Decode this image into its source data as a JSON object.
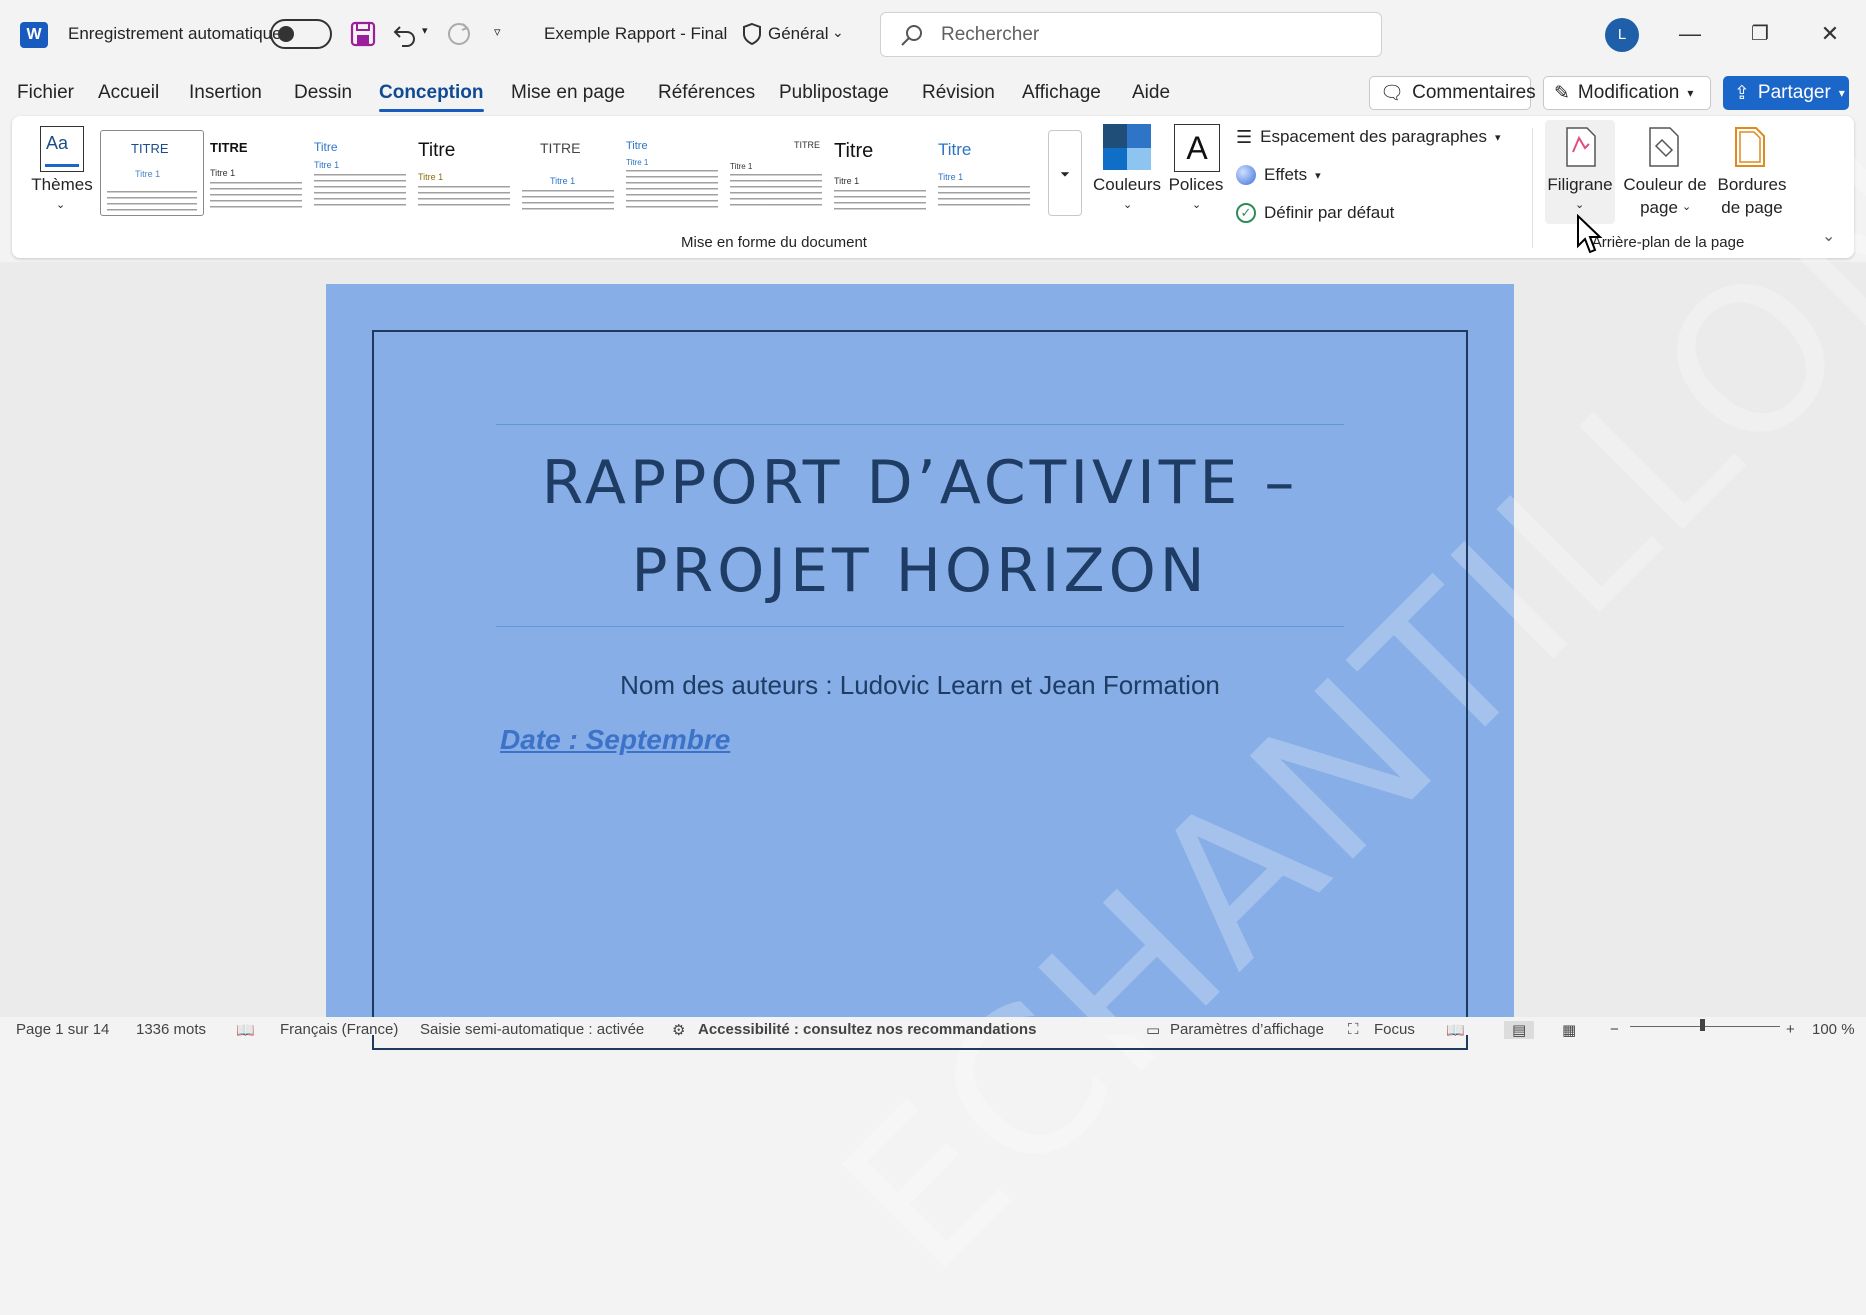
{
  "titlebar": {
    "autosave_label": "Enregistrement automatique",
    "doc_title": "Exemple Rapport - Final",
    "sensitivity": "Général",
    "search_placeholder": "Rechercher",
    "avatar_initial": "L"
  },
  "menu": {
    "tabs": [
      "Fichier",
      "Accueil",
      "Insertion",
      "Dessin",
      "Conception",
      "Mise en page",
      "Références",
      "Publipostage",
      "Révision",
      "Affichage",
      "Aide"
    ],
    "active_tab": "Conception",
    "comments": "Commentaires",
    "mode": "Modification",
    "share": "Partager"
  },
  "ribbon": {
    "themes": "Thèmes",
    "gallery": [
      {
        "title": "TITRE",
        "sub": "Titre 1"
      },
      {
        "title": "TITRE",
        "sub": "Titre 1"
      },
      {
        "title": "Titre",
        "sub": "Titre 1"
      },
      {
        "title": "Titre",
        "sub": "Titre 1"
      },
      {
        "title": "TITRE",
        "sub": "Titre 1"
      },
      {
        "title": "Titre",
        "sub": "Titre 1"
      },
      {
        "title": "TITRE",
        "sub": "Titre 1"
      },
      {
        "title": "Titre",
        "sub": "Titre 1"
      },
      {
        "title": "Titre",
        "sub": "Titre 1"
      }
    ],
    "couleurs": "Couleurs",
    "polices": "Polices",
    "espacement": "Espacement des paragraphes",
    "effets": "Effets",
    "definir": "Définir par défaut",
    "group_doc": "Mise en forme du document",
    "filigrane": "Filigrane",
    "couleur_page_1": "Couleur de",
    "couleur_page_2": "page",
    "bordures_1": "Bordures",
    "bordures_2": "de page",
    "group_bg": "Arrière-plan de la page"
  },
  "document": {
    "title_line1": "RAPPORT D’ACTIVITE –",
    "title_line2": "PROJET HORIZON",
    "authors": "Nom des auteurs : Ludovic Learn et Jean Formation",
    "date": "Date : Septembre",
    "watermark": "ECHANTILLON"
  },
  "statusbar": {
    "page": "Page 1 sur 14",
    "words": "1336 mots",
    "language": "Français (France)",
    "autocomplete": "Saisie semi-automatique : activée",
    "accessibility": "Accessibilité : consultez nos recommandations",
    "display": "Paramètres d’affichage",
    "focus": "Focus",
    "zoom": "100 %"
  },
  "colors": {
    "accent": "#185abd",
    "page_bg": "#87aee6",
    "title_text": "#1e3c64"
  }
}
